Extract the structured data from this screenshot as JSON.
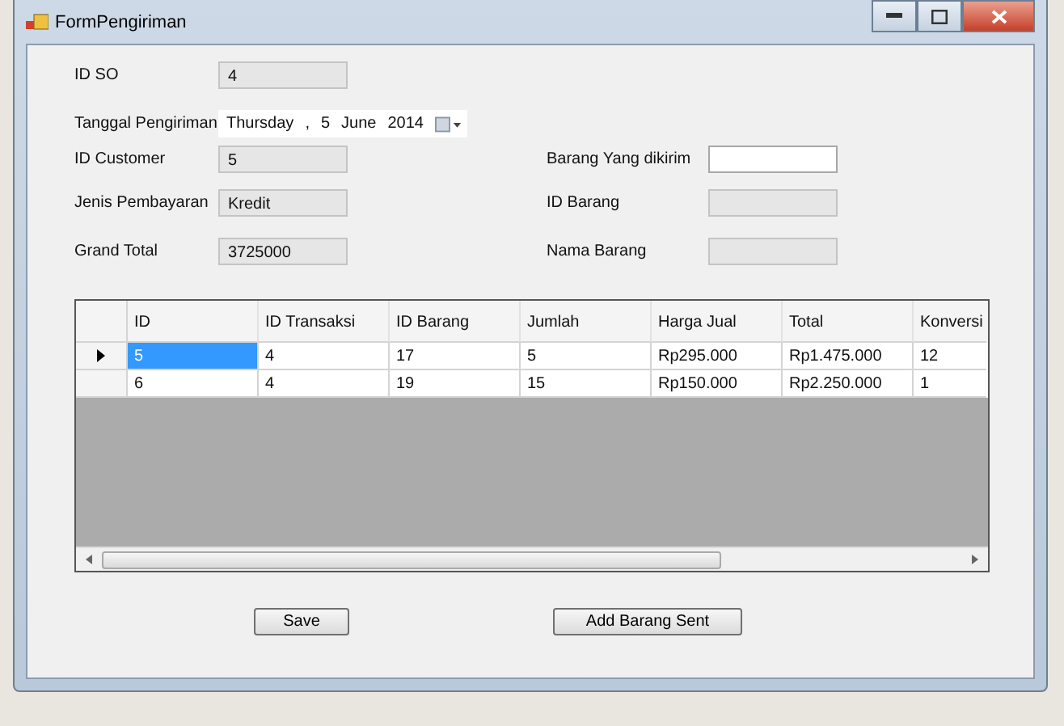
{
  "window": {
    "title": "FormPengiriman"
  },
  "left_fields": [
    {
      "label": "ID SO",
      "value": "4",
      "readonly": true
    },
    {
      "kind": "date",
      "label": "Tanggal Pengiriman",
      "parts": [
        "Thursday",
        ",",
        "5",
        "June",
        "2014"
      ]
    },
    {
      "label": "ID Customer",
      "value": "5",
      "readonly": true
    },
    {
      "label": "Jenis Pembayaran",
      "value": "Kredit",
      "readonly": true
    },
    {
      "label": "Grand Total",
      "value": "3725000",
      "readonly": true
    }
  ],
  "right_fields": [
    {
      "label": "Barang Yang dikirim",
      "readonly": false
    },
    {
      "label": "ID Barang",
      "readonly": true
    },
    {
      "label": "Nama Barang",
      "readonly": true
    }
  ],
  "table": {
    "columns": [
      "ID",
      "ID Transaksi",
      "ID Barang",
      "Jumlah",
      "Harga Jual",
      "Total",
      "Konversi"
    ],
    "rows": [
      {
        "selected": true,
        "cells": [
          "5",
          "4",
          "17",
          "5",
          "Rp295.000",
          "Rp1.475.000",
          "12"
        ]
      },
      {
        "selected": false,
        "cells": [
          "6",
          "4",
          "19",
          "15",
          "Rp150.000",
          "Rp2.250.000",
          "1"
        ]
      }
    ]
  },
  "buttons": [
    "Save",
    "Add Barang Sent"
  ]
}
